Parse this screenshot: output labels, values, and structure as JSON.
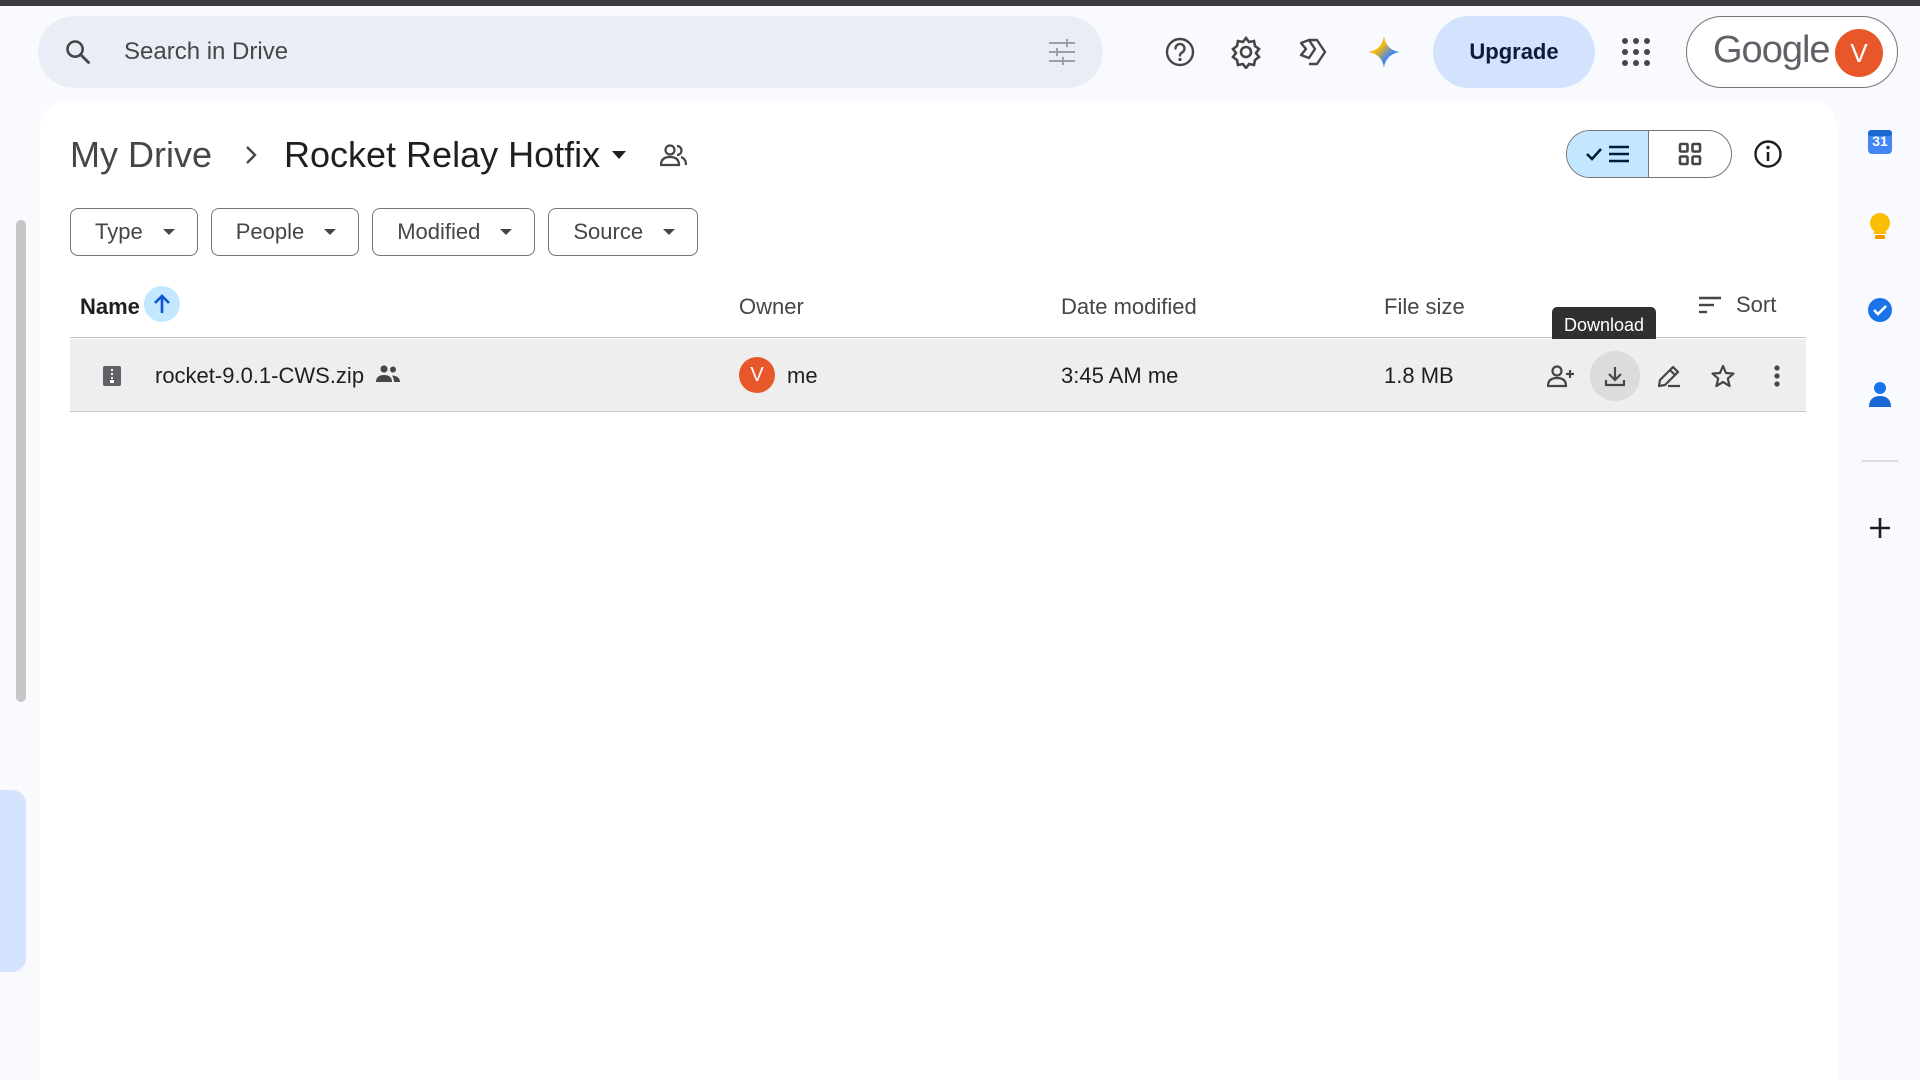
{
  "header": {
    "search_placeholder": "Search in Drive",
    "upgrade_label": "Upgrade",
    "google_label": "Google",
    "avatar_initial": "V",
    "icons": [
      "help-icon",
      "settings-icon",
      "gemini-drive-icon",
      "gemini-spark-icon",
      "apps-grid-icon"
    ]
  },
  "breadcrumb": {
    "root": "My Drive",
    "current": "Rocket Relay Hotfix"
  },
  "filters": [
    {
      "label": "Type"
    },
    {
      "label": "People"
    },
    {
      "label": "Modified"
    },
    {
      "label": "Source"
    }
  ],
  "view": {
    "mode": "list"
  },
  "table": {
    "headers": {
      "name": "Name",
      "owner": "Owner",
      "date_modified": "Date modified",
      "file_size": "File size",
      "sort": "Sort"
    },
    "rows": [
      {
        "name": "rocket-9.0.1-CWS.zip",
        "owner_initial": "V",
        "owner": "me",
        "date_modified": "3:45 AM me",
        "file_size": "1.8 MB"
      }
    ]
  },
  "tooltip": "Download",
  "side_panel": {
    "calendar_label": "31",
    "icons": [
      "calendar-icon",
      "keep-icon",
      "tasks-icon",
      "contacts-icon",
      "add-icon"
    ]
  },
  "colors": {
    "accent": "#0b57d0",
    "selected_bg": "#c2e7ff",
    "upgrade_bg": "#d3e3fd",
    "avatar": "#e8572a"
  }
}
